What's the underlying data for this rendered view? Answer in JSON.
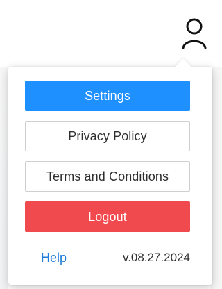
{
  "header": {
    "user_icon": "user-icon"
  },
  "menu": {
    "settings_label": "Settings",
    "privacy_label": "Privacy Policy",
    "terms_label": "Terms and Conditions",
    "logout_label": "Logout"
  },
  "footer": {
    "help_label": "Help",
    "version": "v.08.27.2024"
  },
  "colors": {
    "primary": "#1e90ff",
    "danger": "#f04a4f",
    "link": "#1f7fd8",
    "border": "#cfcfcf",
    "text": "#2f2f2f"
  }
}
